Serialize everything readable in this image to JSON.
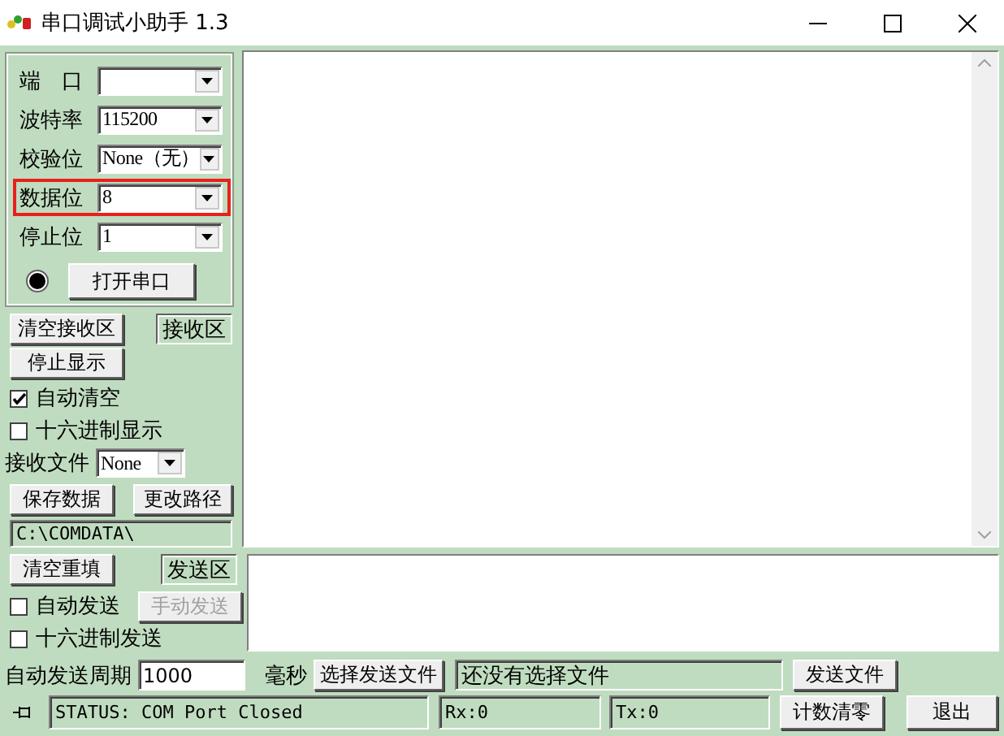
{
  "window": {
    "title": "串口调试小助手 1.3"
  },
  "serial_settings": [
    {
      "label": "端　口",
      "highlighted": false
    },
    {
      "label": "波特率",
      "value": "115200",
      "highlighted": false
    },
    {
      "label": "校验位",
      "value": "None（无）",
      "highlighted": false
    },
    {
      "label": "数据位",
      "value": "8",
      "highlighted": true
    },
    {
      "label": "停止位",
      "value": "1",
      "highlighted": false
    }
  ],
  "open_button": "打开串口",
  "receive": {
    "clear_button": "清空接收区",
    "area_label": "接收区",
    "stop_button": "停止显示",
    "options": [
      {
        "label": "自动清空",
        "checked": true
      },
      {
        "label": "十六进制显示",
        "checked": false
      }
    ],
    "file_label": "接收文件",
    "file_value": "None",
    "save_button": "保存数据",
    "change_path_button": "更改路径",
    "path": "C:\\COMDATA\\"
  },
  "send": {
    "clear_button": "清空重填",
    "area_label": "发送区",
    "auto_send": {
      "label": "自动发送",
      "checked": false
    },
    "manual_button": {
      "label": "手动发送",
      "disabled": true
    },
    "hex_send": {
      "label": "十六进制发送",
      "checked": false
    },
    "period_label": "自动发送周期",
    "period_value": "1000",
    "period_unit": "毫秒",
    "choose_file_button": "选择发送文件",
    "file_status": "还没有选择文件",
    "send_file_button": "发送文件"
  },
  "status_bar": {
    "status": "STATUS: COM Port Closed",
    "rx": "Rx:0",
    "tx": "Tx:0",
    "reset_button": "计数清零",
    "exit_button": "退出"
  }
}
